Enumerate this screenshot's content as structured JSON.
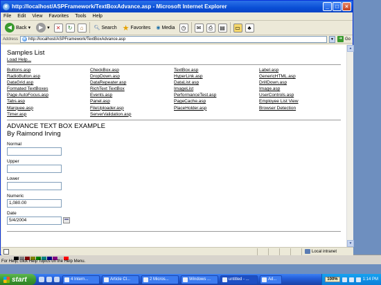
{
  "window": {
    "title": "http://localhost/ASPFramework/TextBoxAdvance.asp - Microsoft Internet Explorer",
    "controls": {
      "minimize": "_",
      "maximize": "□",
      "close": "×"
    }
  },
  "menu": [
    "File",
    "Edit",
    "View",
    "Favorites",
    "Tools",
    "Help"
  ],
  "toolbar": {
    "back": "Back",
    "search": "Search",
    "favorites": "Favorites",
    "media": "Media"
  },
  "address": {
    "label": "Address",
    "url": "http://localhost/ASPFramework/TextBoxAdvance.asp",
    "go": "Go"
  },
  "page": {
    "samples_title": "Samples List",
    "load_help": "Load Help...",
    "samples": [
      "Buttons.asp",
      "CheckBox.asp",
      "TextBox.asp",
      "Label.asp",
      "RadioButton.asp",
      "DropDown.asp",
      "HyperLink.asp",
      "GenericHTML.asp",
      "DataGrid.asp",
      "DataRepeater.asp",
      "DataList.asp",
      "DrillDown.asp",
      "Formated TextBoxes",
      "RichText TextBox",
      "ImageList",
      "Image.asp",
      "Page AutoFocus.asp",
      "Events.asp",
      "PerformanceTest.asp",
      "UserControls.asp",
      "Tabs.asp",
      "Panel.asp",
      "PageCache.asp",
      "Employee List View",
      "Marquee.asp",
      "FileUploader.asp",
      "PlaceHolder.asp",
      "Browser Detection",
      "Timer.asp",
      "ServerValidation.asp"
    ],
    "example_title": "ADVANCE TEXT BOX EXAMPLE",
    "example_author": "By Raimond Irving",
    "fields": {
      "normal": {
        "label": "Normal",
        "value": ""
      },
      "upper": {
        "label": "Upper",
        "value": ""
      },
      "lower": {
        "label": "Lower",
        "value": ""
      },
      "numeric": {
        "label": "Numeric",
        "value": "1,080.00"
      },
      "date": {
        "label": "Date",
        "value": "5/4/2004"
      }
    }
  },
  "status": {
    "zone": "Local intranet"
  },
  "background_app": {
    "status": "For Help, click Help Topics on the Help Menu."
  },
  "taskbar": {
    "start": "start",
    "buttons": [
      "4 Intern...",
      "Article Cl...",
      "2 Micros...",
      "Windows ...",
      "untitled - ...",
      "Ad..."
    ],
    "zoom": "100%",
    "clock": "1:14 PM"
  },
  "colors": {
    "titlebar": "#0a4fd6",
    "taskbar": "#245edb",
    "start_button": "#3c9a31",
    "window_chrome": "#ece9d8"
  }
}
